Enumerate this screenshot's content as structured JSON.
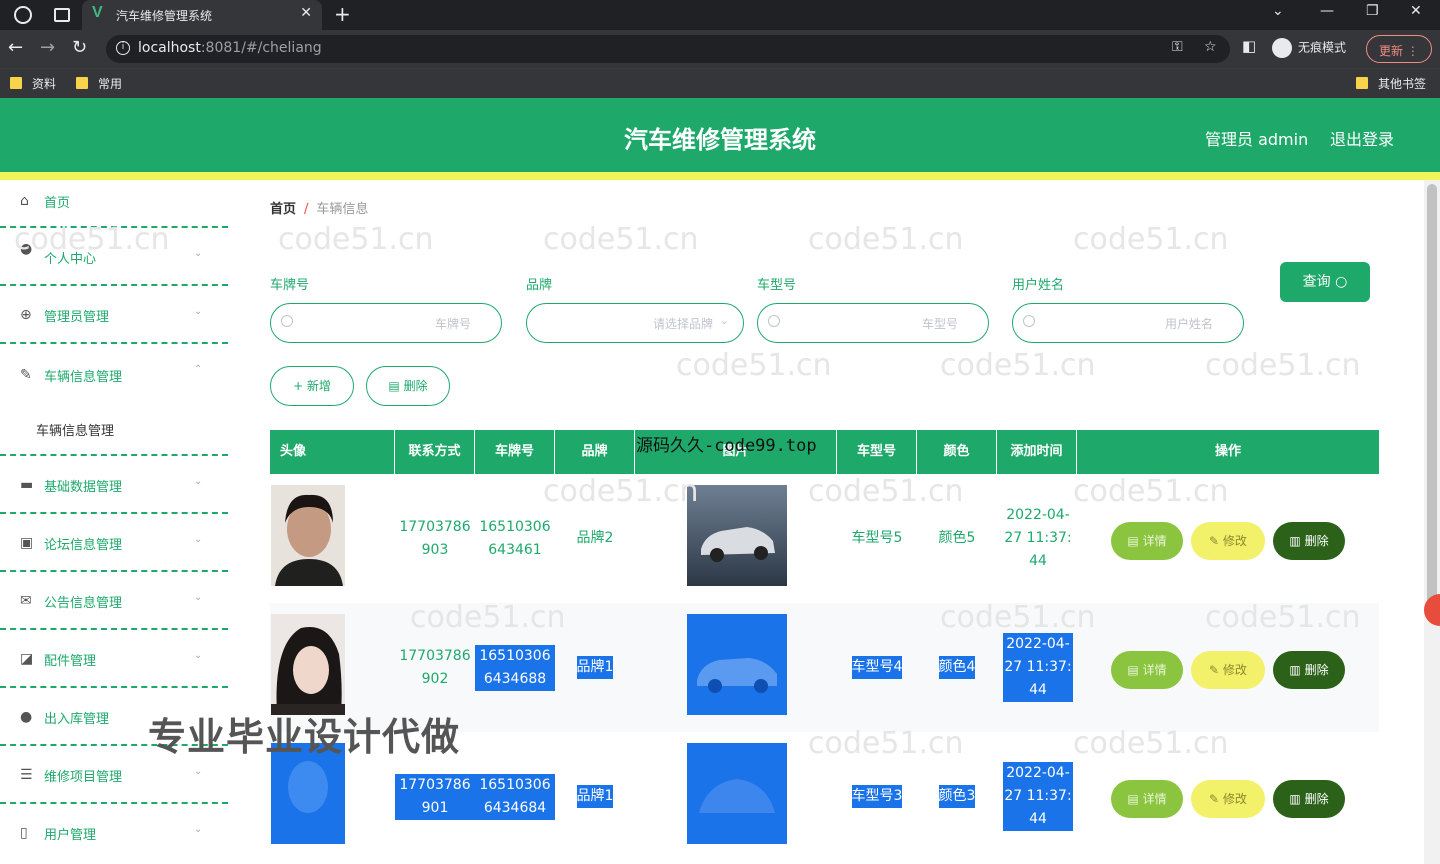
{
  "browser": {
    "tab_title": "汽车维修管理系统",
    "tab_favicon": "V",
    "url_host": "localhost",
    "url_rest": ":8081/#/cheliang",
    "incognito_label": "无痕模式",
    "update_label": "更新",
    "bookmarks": [
      "资料",
      "常用"
    ],
    "other_bookmarks": "其他书签"
  },
  "header": {
    "title": "汽车维修管理系统",
    "admin_label": "管理员 admin",
    "logout_label": "退出登录"
  },
  "sidebar": {
    "items": [
      {
        "label": "首页",
        "icon": "home-icon"
      },
      {
        "label": "个人中心",
        "icon": "user-icon"
      },
      {
        "label": "管理员管理",
        "icon": "admin-icon"
      },
      {
        "label": "车辆信息管理",
        "icon": "car-info-icon"
      },
      {
        "label": "基础数据管理",
        "icon": "data-icon"
      },
      {
        "label": "论坛信息管理",
        "icon": "forum-icon"
      },
      {
        "label": "公告信息管理",
        "icon": "notice-icon"
      },
      {
        "label": "配件管理",
        "icon": "parts-icon"
      },
      {
        "label": "出入库管理",
        "icon": "stock-icon"
      },
      {
        "label": "维修项目管理",
        "icon": "repair-icon"
      },
      {
        "label": "用户管理",
        "icon": "users-icon"
      }
    ],
    "sub_item": "车辆信息管理"
  },
  "breadcrumb": {
    "home": "首页",
    "separator": "/",
    "current": "车辆信息"
  },
  "filters": {
    "plate": {
      "label": "车牌号",
      "placeholder": "车牌号"
    },
    "brand": {
      "label": "品牌",
      "placeholder": "请选择品牌"
    },
    "model": {
      "label": "车型号",
      "placeholder": "车型号"
    },
    "user": {
      "label": "用户姓名",
      "placeholder": "用户姓名"
    },
    "search_label": "查询"
  },
  "actions": {
    "add_label": "+ 新增",
    "delete_label": "删除"
  },
  "table": {
    "headers": [
      "头像",
      "联系方式",
      "车牌号",
      "品牌",
      "图片",
      "车型号",
      "颜色",
      "添加时间",
      "操作"
    ],
    "rows": [
      {
        "phone": "17703786903",
        "plate": "16510306643461",
        "brand": "品牌2",
        "model": "车型号5",
        "color": "颜色5",
        "time": "2022-04-27 11:37:44"
      },
      {
        "phone": "17703786902",
        "plate": "165103066434688",
        "brand": "品牌1",
        "model": "车型号4",
        "color": "颜色4",
        "time": "2022-04-27 11:37:44"
      },
      {
        "phone": "17703786901",
        "plate": "165103066434684",
        "brand": "品牌1",
        "model": "车型号3",
        "color": "颜色3",
        "time": "2022-04-27 11:37:44"
      }
    ],
    "op_detail": "详情",
    "op_edit": "修改",
    "op_delete": "删除"
  },
  "overlays": {
    "watermark": "code51.cn",
    "promo_top": "源码久久-code99.top",
    "promo_big": "专业毕业设计代做"
  },
  "colors": {
    "primary": "#1ea96b",
    "accent_yellow": "#f2f55a",
    "selection": "#1a73e8"
  }
}
